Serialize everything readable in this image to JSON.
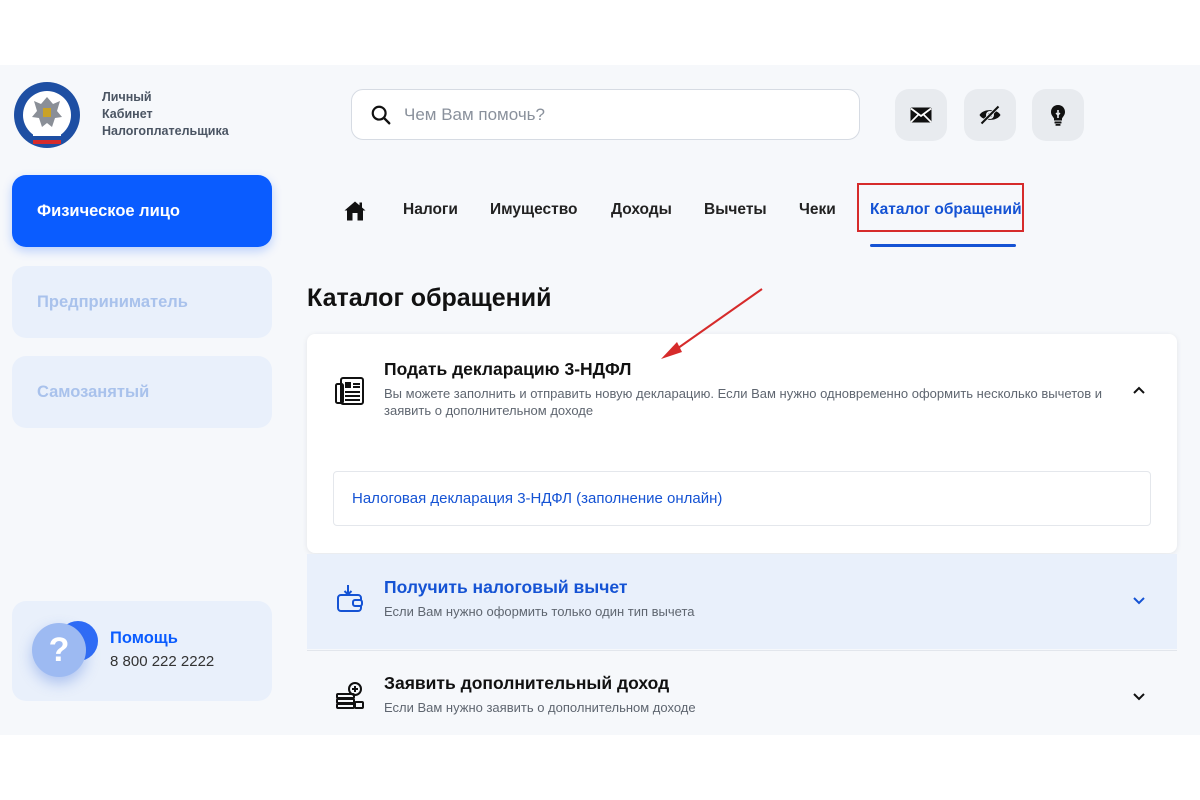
{
  "header": {
    "logo_lines": [
      "Личный",
      "Кабинет",
      "Налогоплательщика"
    ],
    "search_placeholder": "Чем Вам помочь?",
    "icons": [
      "mail-icon",
      "eye-off-icon",
      "lightbulb-icon"
    ]
  },
  "sidebar": {
    "items": [
      {
        "label": "Физическое лицо",
        "active": true
      },
      {
        "label": "Предприниматель",
        "active": false
      },
      {
        "label": "Самозанятый",
        "active": false
      }
    ],
    "help": {
      "title": "Помощь",
      "phone": "8 800 222 2222"
    }
  },
  "nav": {
    "items": [
      "Налоги",
      "Имущество",
      "Доходы",
      "Вычеты",
      "Чеки",
      "Каталог обращений"
    ],
    "active": "Каталог обращений"
  },
  "main": {
    "title": "Каталог обращений",
    "cards": [
      {
        "title": "Подать декларацию 3-НДФЛ",
        "description": "Вы можете заполнить и отправить новую декларацию. Если Вам нужно одновременно оформить несколько вычетов и заявить о дополнительном доходе",
        "expanded": true,
        "sub_items": [
          "Налоговая декларация 3-НДФЛ (заполнение онлайн)"
        ]
      },
      {
        "title": "Получить налоговый вычет",
        "description": "Если Вам нужно оформить только один тип вычета",
        "expanded": false
      },
      {
        "title": "Заявить дополнительный доход",
        "description": "Если Вам нужно заявить о дополнительном доходе",
        "expanded": false
      }
    ]
  },
  "colors": {
    "accent": "#0a5cff",
    "annotation": "#d62b2b"
  }
}
